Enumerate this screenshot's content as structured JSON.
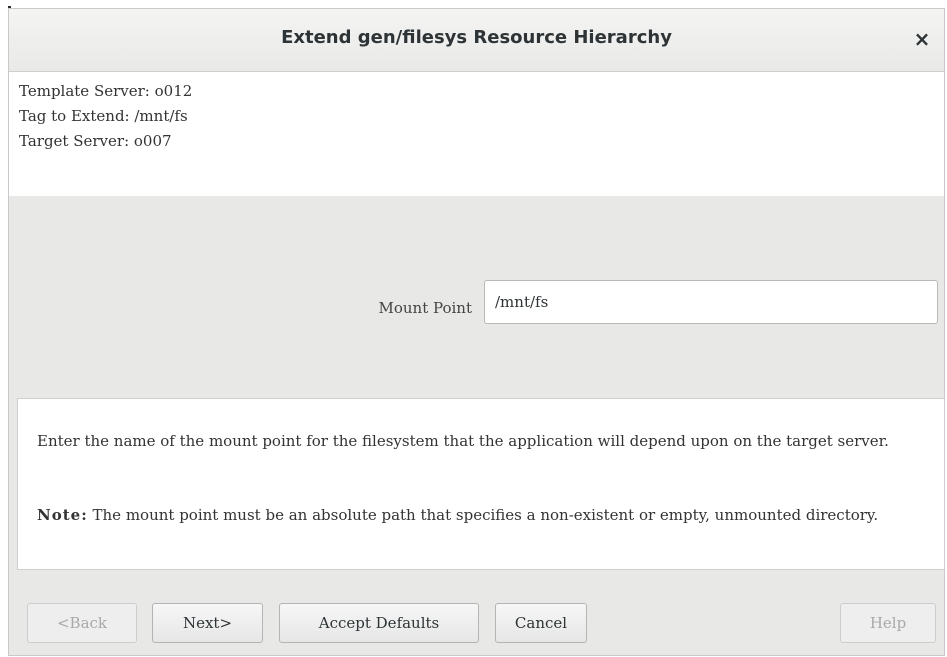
{
  "dialog": {
    "title": "Extend gen/filesys Resource Hierarchy",
    "close_icon": "close-icon",
    "close_glyph": "×"
  },
  "info": {
    "template_server": "Template Server: o012",
    "tag_to_extend": "Tag to Extend: /mnt/fs",
    "target_server": "Target Server: o007"
  },
  "form": {
    "mount_point_label": "Mount Point",
    "mount_point_value": "/mnt/fs"
  },
  "help": {
    "description": "Enter the name of the mount point for the filesystem that the application will depend upon on the target server.",
    "note_label": "Note:",
    "note_text": "The mount point must be an absolute path that specifies a non-existent or empty, unmounted directory."
  },
  "buttons": {
    "back": {
      "label": "<Back",
      "enabled": false
    },
    "next": {
      "label": "Next>",
      "enabled": true
    },
    "accept_defaults": {
      "label": "Accept Defaults",
      "enabled": true
    },
    "cancel": {
      "label": "Cancel",
      "enabled": true
    },
    "help": {
      "label": "Help",
      "enabled": false
    }
  },
  "colors": {
    "dialog_background": "#e8e8e7",
    "panel_background": "#ffffff",
    "text": "#333333",
    "disabled_text": "#a9a9a9"
  }
}
